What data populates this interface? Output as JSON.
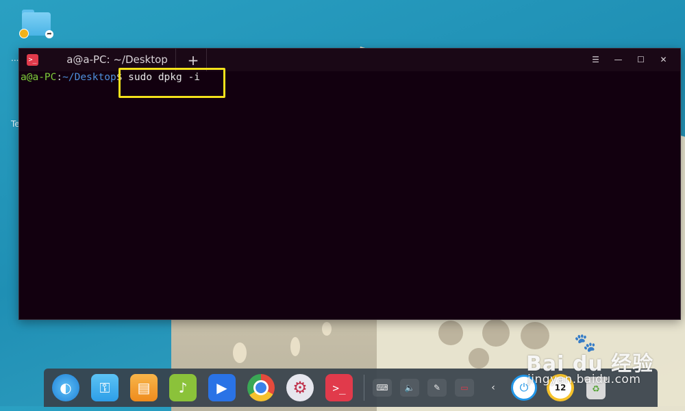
{
  "desktop": {
    "dots_label": "...",
    "te_label": "Te"
  },
  "terminal": {
    "app_icon_glyph": ">_",
    "tab_title": "a@a-PC: ~/Desktop",
    "add_tab_glyph": "+",
    "menu_glyph": "☰",
    "minimize_glyph": "—",
    "maximize_glyph": "☐",
    "close_glyph": "✕",
    "prompt_user": "a@a-PC",
    "prompt_colon": ":",
    "prompt_path": "~/Desktop",
    "prompt_dollar": "$",
    "command": " sudo dpkg -i",
    "highlight_color": "#f3e21b"
  },
  "dock": {
    "apps": [
      {
        "name": "launcher",
        "icon": "deepin-logo-icon",
        "color": "#1e7fd6"
      },
      {
        "name": "file-manager",
        "icon": "file-manager-icon",
        "color": "#2d9ee8"
      },
      {
        "name": "app-store",
        "icon": "store-bag-icon",
        "color": "#f39b2a"
      },
      {
        "name": "music",
        "icon": "music-icon",
        "color": "#8bc23a"
      },
      {
        "name": "video",
        "icon": "video-icon",
        "color": "#2a73e6"
      },
      {
        "name": "chrome",
        "icon": "chrome-icon",
        "color": "#e64a3c"
      },
      {
        "name": "settings",
        "icon": "gear-icon",
        "color": "#d6d6de"
      },
      {
        "name": "terminal",
        "icon": "terminal-icon",
        "color": "#e13a4b"
      }
    ],
    "tray": [
      {
        "name": "keyboard",
        "glyph": "⌨"
      },
      {
        "name": "volume",
        "glyph": "🔈"
      },
      {
        "name": "pen",
        "glyph": "✎"
      },
      {
        "name": "battery",
        "glyph": "▭"
      }
    ],
    "chevron": "‹",
    "clock_text": "12"
  },
  "watermark": {
    "main": "Bai du 经验",
    "sub": "jingyan.baidu.com"
  }
}
